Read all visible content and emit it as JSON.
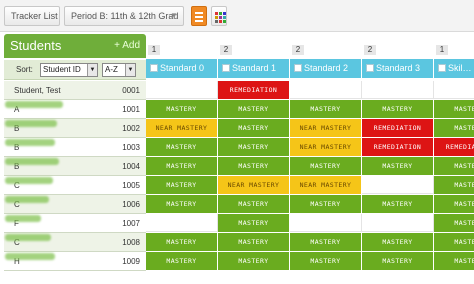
{
  "toolbar": {
    "tracker_list": "Tracker List",
    "period": "Period B: 11th & 12th Grad",
    "accent_color": "#f08a24"
  },
  "students_panel": {
    "title": "Students",
    "add_label": "+ Add",
    "sort_label": "Sort:",
    "sort_by": "Student ID",
    "sort_order": "A-Z",
    "header_color": "#6fae3a"
  },
  "students": [
    {
      "name": "Student, Test",
      "id": "0001",
      "redacted": false
    },
    {
      "name": "A",
      "id": "1001",
      "redacted": true
    },
    {
      "name": "B",
      "id": "1002",
      "redacted": true
    },
    {
      "name": "B",
      "id": "1003",
      "redacted": true
    },
    {
      "name": "B",
      "id": "1004",
      "redacted": true
    },
    {
      "name": "C",
      "id": "1005",
      "redacted": true
    },
    {
      "name": "C",
      "id": "1006",
      "redacted": true
    },
    {
      "name": "F",
      "id": "1007",
      "redacted": true
    },
    {
      "name": "C",
      "id": "1008",
      "redacted": true
    },
    {
      "name": "H",
      "id": "1009",
      "redacted": true
    }
  ],
  "column_numbers": [
    "1",
    "2",
    "2",
    "2",
    "1"
  ],
  "standards": [
    "Standard 0",
    "Standard 1",
    "Standard 2",
    "Standard 3",
    "Skil…"
  ],
  "levels": {
    "mastery": "MASTERY",
    "near": "NEAR MASTERY",
    "remed": "REMEDIATION",
    "empty": ""
  },
  "level_colors": {
    "mastery": "#6aac1f",
    "near": "#f5c518",
    "remed": "#dd1414",
    "standard_header": "#5bc6e0"
  },
  "grid": [
    [
      "empty",
      "remed",
      "empty",
      "empty",
      "empty"
    ],
    [
      "mastery",
      "mastery",
      "mastery",
      "mastery",
      "mastery"
    ],
    [
      "near",
      "mastery",
      "near",
      "remed",
      "mastery"
    ],
    [
      "mastery",
      "mastery",
      "near",
      "remed",
      "remed"
    ],
    [
      "mastery",
      "mastery",
      "mastery",
      "mastery",
      "mastery"
    ],
    [
      "mastery",
      "near",
      "near",
      "empty",
      "mastery"
    ],
    [
      "mastery",
      "mastery",
      "mastery",
      "mastery",
      "mastery"
    ],
    [
      "empty",
      "mastery",
      "empty",
      "empty",
      "mastery"
    ],
    [
      "mastery",
      "mastery",
      "mastery",
      "mastery",
      "mastery"
    ],
    [
      "mastery",
      "mastery",
      "mastery",
      "mastery",
      "mastery"
    ]
  ]
}
